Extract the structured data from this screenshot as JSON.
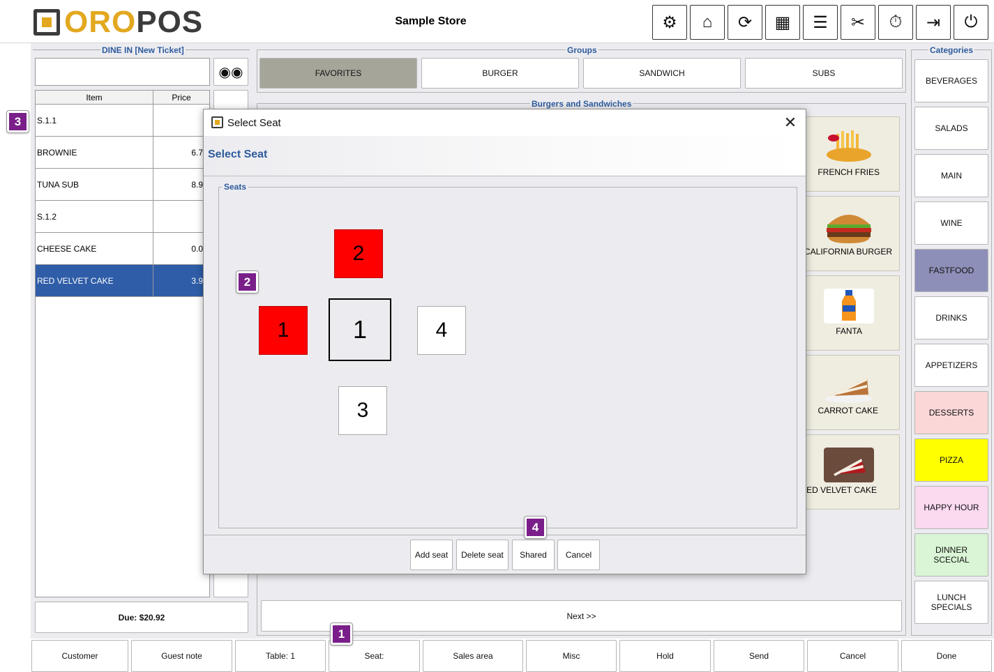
{
  "header": {
    "logo_oro": "ORO",
    "logo_pos": "POS",
    "store_name": "Sample Store",
    "toolbar": [
      {
        "icon": "gear-icon",
        "glyph": "⚙"
      },
      {
        "icon": "home-icon",
        "glyph": "⌂"
      },
      {
        "icon": "refresh-icon",
        "glyph": "⟳"
      },
      {
        "icon": "grid-icon",
        "glyph": "▦"
      },
      {
        "icon": "list-icon",
        "glyph": "☰"
      },
      {
        "icon": "tools-icon",
        "glyph": "✂"
      },
      {
        "icon": "clock-icon",
        "glyph": "⏱"
      },
      {
        "icon": "logout-icon",
        "glyph": "⇥"
      },
      {
        "icon": "power-icon",
        "glyph": "⏻"
      }
    ]
  },
  "ticket": {
    "title": "DINE IN [New Ticket]",
    "search_value": "",
    "search_icon": "binoculars-icon",
    "columns": [
      "Item",
      "Price"
    ],
    "rows": [
      {
        "name": "S.1.1",
        "price": ""
      },
      {
        "name": "BROWNIE",
        "price": "6.7"
      },
      {
        "name": "TUNA SUB",
        "price": "8.9"
      },
      {
        "name": "S.1.2",
        "price": ""
      },
      {
        "name": "CHEESE CAKE",
        "price": "0.0"
      },
      {
        "name": "RED VELVET CAKE",
        "price": "3.9"
      }
    ],
    "due": "Due: $20.92"
  },
  "groups": {
    "title": "Groups",
    "items": [
      "FAVORITES",
      "BURGER",
      "SANDWICH",
      "SUBS"
    ]
  },
  "menu": {
    "title": "Burgers and Sandwiches",
    "items": [
      "FRENCH FRIES",
      "CALIFORNIA BURGER",
      "FANTA",
      "CARROT CAKE",
      "RED VELVET CAKE"
    ],
    "next_label": "Next >>"
  },
  "categories": {
    "title": "Categories",
    "items": [
      {
        "label": "BEVERAGES",
        "color": "#ffffff"
      },
      {
        "label": "SALADS",
        "color": "#ffffff"
      },
      {
        "label": "MAIN",
        "color": "#ffffff"
      },
      {
        "label": "WINE",
        "color": "#ffffff"
      },
      {
        "label": "FASTFOOD",
        "color": "#8e8fb8"
      },
      {
        "label": "DRINKS",
        "color": "#ffffff"
      },
      {
        "label": "APPETIZERS",
        "color": "#ffffff"
      },
      {
        "label": "DESSERTS",
        "color": "#fbd7d7"
      },
      {
        "label": "PIZZA",
        "color": "#ffff00"
      },
      {
        "label": "HAPPY HOUR",
        "color": "#fbd9ef"
      },
      {
        "label": "DINNER SCECIAL",
        "color": "#daf5d5"
      },
      {
        "label": "LUNCH SPECIALS",
        "color": "#ffffff"
      }
    ]
  },
  "bottom_bar": [
    "Customer",
    "Guest note",
    "Table: 1",
    "Seat:",
    "Sales area",
    "Misc",
    "Hold",
    "Send",
    "Cancel",
    "Done"
  ],
  "dialog": {
    "window_title": "Select Seat",
    "heading": "Select Seat",
    "seats_label": "Seats",
    "seats": [
      {
        "label": "2",
        "state": "occupied"
      },
      {
        "label": "1",
        "state": "occupied"
      },
      {
        "label": "1",
        "state": "current"
      },
      {
        "label": "4",
        "state": "free"
      },
      {
        "label": "3",
        "state": "free"
      }
    ],
    "buttons": [
      "Add seat",
      "Delete seat",
      "Shared",
      "Cancel"
    ],
    "close_glyph": "✕"
  },
  "markers": [
    "1",
    "2",
    "3",
    "4"
  ],
  "colors": {
    "accent_blue": "#2e5b9c",
    "selected_row": "#2f5da8",
    "occupied_seat": "#ff0000",
    "marker": "#7a1f8a",
    "logo_gold": "#e2a81f"
  }
}
